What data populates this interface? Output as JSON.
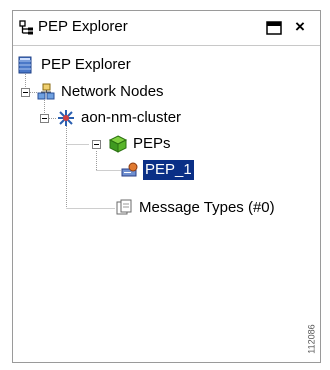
{
  "panel": {
    "title": "PEP Explorer",
    "title_icon": "explorer-tree-icon",
    "maximize_icon": "maximize-icon",
    "close_label": "×"
  },
  "tree": {
    "root": {
      "label": "PEP Explorer",
      "icon": "database-icon"
    },
    "network_nodes": {
      "label": "Network Nodes",
      "icon": "network-nodes-icon",
      "expanded": true
    },
    "cluster": {
      "label": "aon-nm-cluster",
      "icon": "cluster-icon",
      "expanded": true
    },
    "peps": {
      "label": "PEPs",
      "icon": "peps-cube-icon",
      "expanded": true
    },
    "pep_1": {
      "label": "PEP_1",
      "icon": "pep-node-icon",
      "selected": true
    },
    "message_types": {
      "label": "Message Types (#0)",
      "icon": "message-types-icon"
    }
  },
  "watermark": "112086",
  "colors": {
    "selection": "#0a2f86",
    "panel_border": "#9a9a9a"
  }
}
